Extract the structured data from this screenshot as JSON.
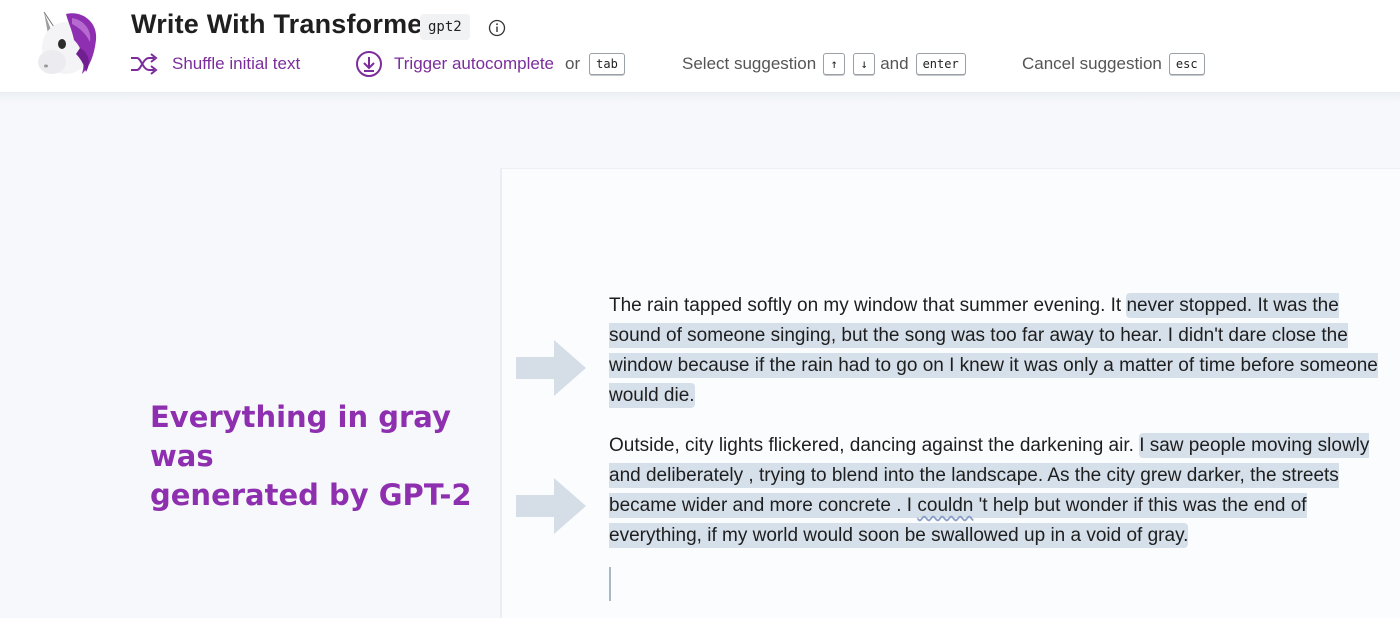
{
  "header": {
    "title": "Write With Transformer",
    "model": "gpt2"
  },
  "toolbar": {
    "shuffle_label": "Shuffle initial text",
    "trigger_label": "Trigger autocomplete",
    "or_label": "or",
    "tab_key": "tab",
    "select_label": "Select suggestion",
    "up_key": "↑",
    "down_key": "↓",
    "and_label": "and",
    "enter_key": "enter",
    "cancel_label": "Cancel suggestion",
    "esc_key": "esc"
  },
  "annotation": {
    "line1": "Everything in gray was",
    "line2": "generated by GPT-2"
  },
  "editor": {
    "para1_prompt": "The rain tapped softly on my window that summer evening. It ",
    "para1_generated": "never stopped. It was the sound of someone singing, but the song was too far away to hear. I didn't dare close the window because if the rain had to go on I knew it was only a matter of time before someone would die.",
    "para2_prompt": "Outside, city lights flickered, dancing against the darkening air. ",
    "para2_gen_a": " I saw people moving slowly and deliberately , trying to blend into the landscape. As the city grew darker, the streets became wider and more concrete . I ",
    "para2_gen_squiggle": "couldn",
    "para2_gen_b": " 't help but wonder if this was the end of everything, if my world would soon be swallowed up in a void of gray."
  },
  "colors": {
    "accent": "#7b2d9c",
    "annotation": "#8e2fb0",
    "generated_highlight": "#d6e0ea",
    "arrow": "#d5dee7"
  },
  "icons": {
    "logo": "unicorn-logo",
    "info": "info-icon",
    "shuffle": "shuffle-icon",
    "trigger": "download-circle-icon",
    "arrows": "right-arrow-icon"
  }
}
